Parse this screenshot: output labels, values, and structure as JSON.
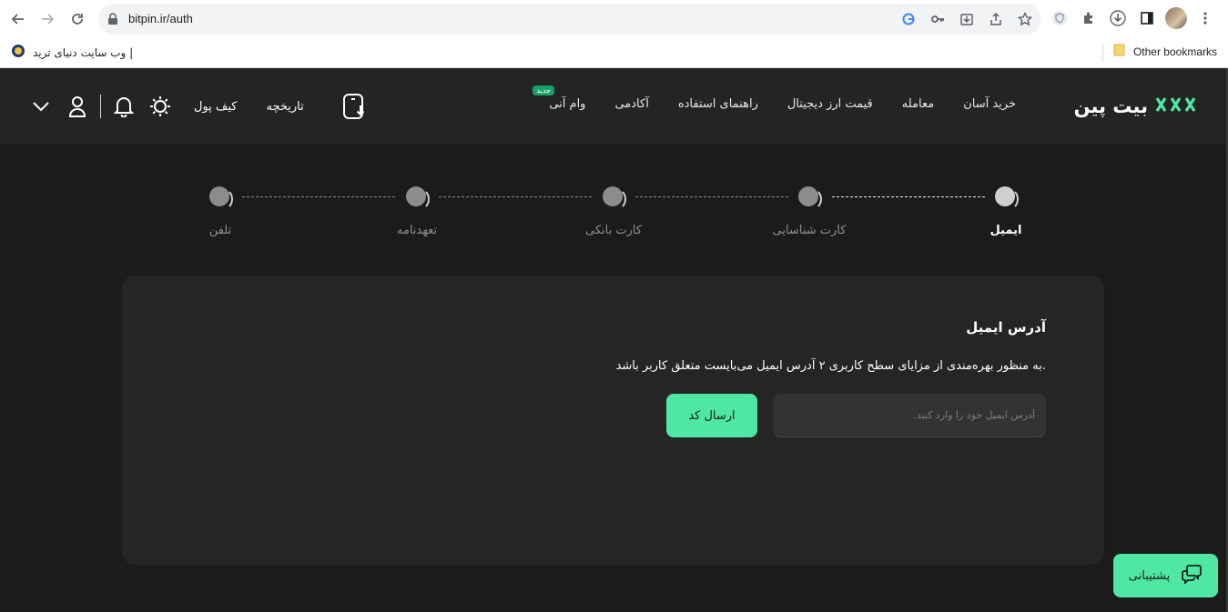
{
  "browser": {
    "url": "bitpin.ir/auth",
    "bookmark_left": "وب سایت دنیای ترید |",
    "bookmark_right": "Other bookmarks"
  },
  "header": {
    "logo_text": "بیت پین",
    "nav": [
      {
        "label": "خرید آسان"
      },
      {
        "label": "معامله"
      },
      {
        "label": "قیمت ارز دیجیتال"
      },
      {
        "label": "راهنمای استفاده"
      },
      {
        "label": "آکادمی"
      },
      {
        "label": "وام آنی",
        "badge": "جدید"
      }
    ],
    "history_label": "تاریخچه",
    "wallet_label": "کیف پول"
  },
  "stepper": {
    "steps": [
      {
        "label": "ایمیل",
        "active": true
      },
      {
        "label": "کارت شناسایی",
        "active": false
      },
      {
        "label": "کارت بانکی",
        "active": false
      },
      {
        "label": "تعهدنامه",
        "active": false
      },
      {
        "label": "تلفن",
        "active": false
      }
    ]
  },
  "card": {
    "title": "آدرس ایمیل",
    "description": "به منظور بهره‌مندی از مزایای سطح کاربری ۲ آدرس ایمیل می‌بایست متعلق کاربر باشد.",
    "email_placeholder": "آدرس ایمیل خود را وارد کنید.",
    "email_value": "",
    "send_button": "ارسال کد"
  },
  "support": {
    "label": "پشتیبانی"
  },
  "colors": {
    "accent": "#4fe8a2",
    "background": "#1b1b1b",
    "header": "#242424",
    "card": "#252525",
    "badge": "#15a36a"
  }
}
